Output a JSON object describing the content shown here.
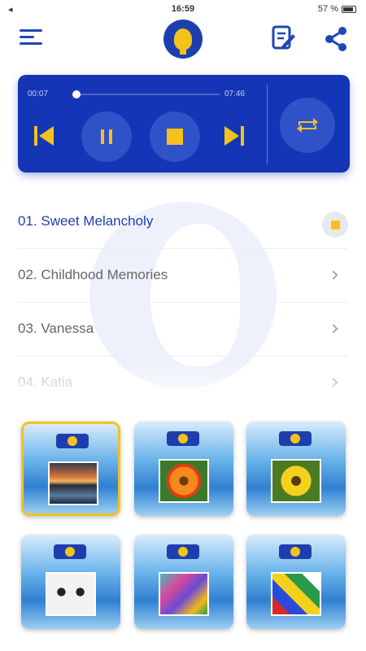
{
  "status_bar": {
    "left_glyph": "◂",
    "time": "16:59",
    "battery_text": "57 %"
  },
  "player": {
    "elapsed": "00:07",
    "total": "07:46",
    "progress_fraction": 0.02,
    "accent_color": "#f4c21b",
    "panel_color": "#1435b5"
  },
  "tracks": [
    {
      "title": "01. Sweet Melancholy",
      "state": "playing"
    },
    {
      "title": "02. Childhood Memories",
      "state": "idle"
    },
    {
      "title": "03. Vanessa",
      "state": "idle"
    },
    {
      "title": "04. Katia",
      "state": "idle"
    }
  ],
  "albums": [
    {
      "picture": "sunset",
      "selected": true
    },
    {
      "picture": "flower",
      "selected": false
    },
    {
      "picture": "sunflower",
      "selected": false
    },
    {
      "picture": "sketch",
      "selected": false
    },
    {
      "picture": "abstract",
      "selected": false
    },
    {
      "picture": "mosaic",
      "selected": false
    }
  ],
  "icons": {
    "menu": "menu-icon",
    "logo": "lightbulb-logo",
    "edit": "edit-note-icon",
    "share": "share-icon",
    "prev": "skip-previous-icon",
    "pause": "pause-icon",
    "stop": "stop-icon",
    "next": "skip-next-icon",
    "repeat": "repeat-icon"
  }
}
